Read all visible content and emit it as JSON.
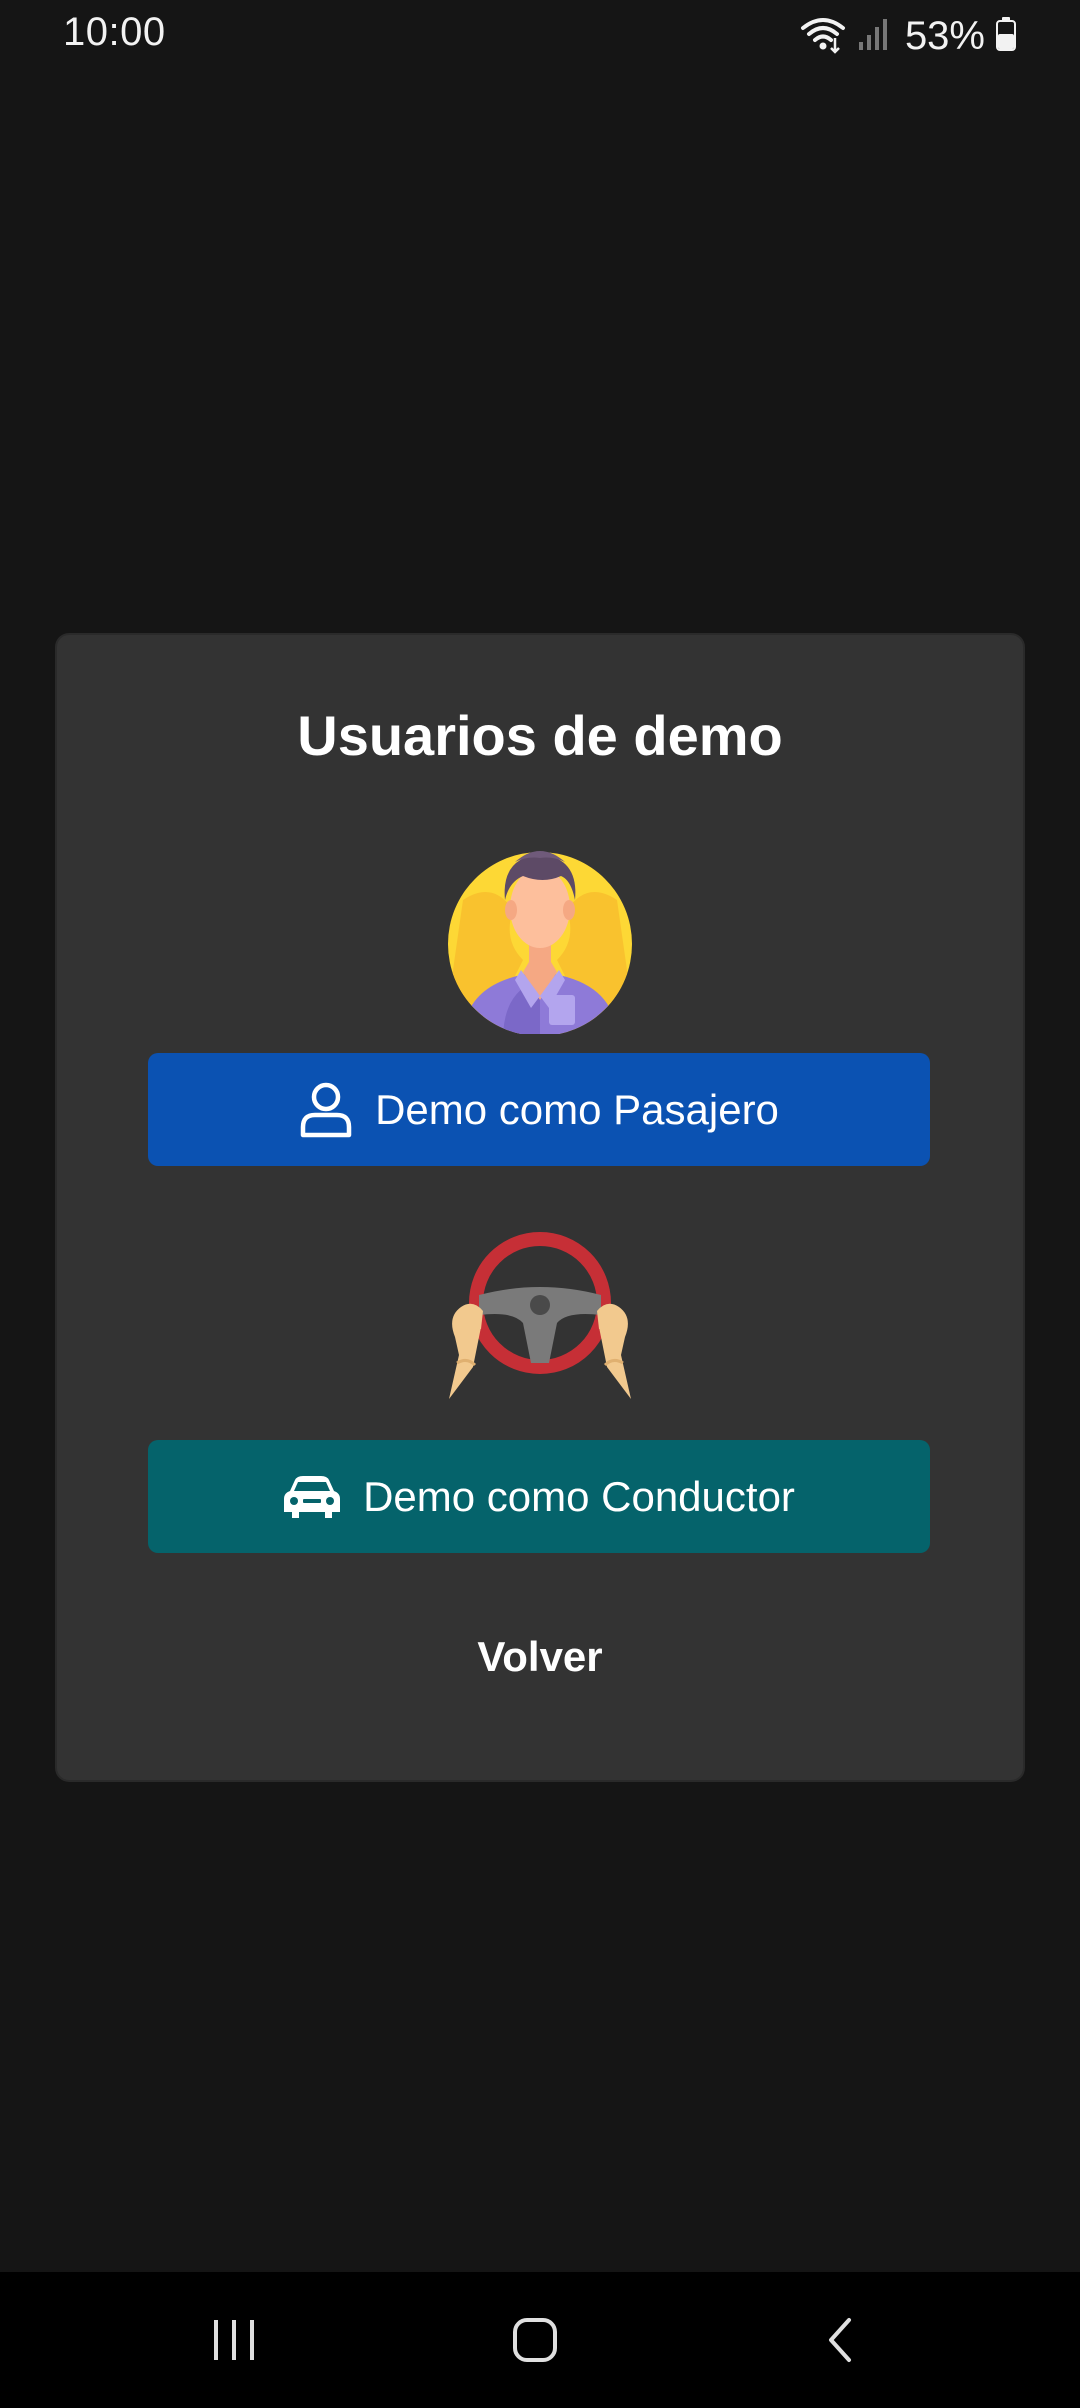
{
  "status_bar": {
    "time": "10:00",
    "battery": "53%",
    "icons": [
      "wifi-icon",
      "signal-icon",
      "battery-icon"
    ]
  },
  "dialog": {
    "title": "Usuarios de demo",
    "passenger_button": {
      "label": "Demo como Pasajero",
      "icon": "user-icon",
      "color": "#0b52b2"
    },
    "driver_button": {
      "label": "Demo como Conductor",
      "icon": "car-icon",
      "color": "#05636b"
    },
    "back_label": "Volver"
  },
  "nav_bar": {
    "items": [
      "recents-icon",
      "home-icon",
      "back-icon"
    ]
  },
  "colors": {
    "background": "#151515",
    "dialog": "#333333"
  }
}
